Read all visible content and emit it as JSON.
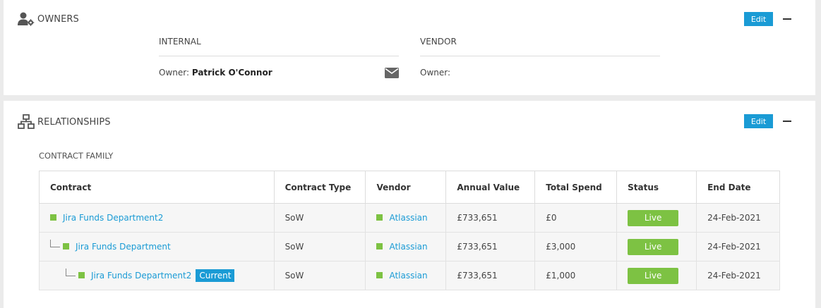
{
  "owners": {
    "title": "OWNERS",
    "edit_label": "Edit",
    "internal": {
      "heading": "INTERNAL",
      "owner_label": "Owner:",
      "owner_name": "Patrick O'Connor"
    },
    "vendor": {
      "heading": "VENDOR",
      "owner_label": "Owner:"
    }
  },
  "relationships": {
    "title": "RELATIONSHIPS",
    "edit_label": "Edit",
    "family_label": "CONTRACT FAMILY",
    "columns": [
      "Contract",
      "Contract Type",
      "Vendor",
      "Annual Value",
      "Total Spend",
      "Status",
      "End Date"
    ],
    "rows": [
      {
        "contract": "Jira Funds Department2",
        "type": "SoW",
        "vendor": "Atlassian",
        "annual_value": "£733,651",
        "total_spend": "£0",
        "status": "Live",
        "end_date": "24-Feb-2021"
      },
      {
        "contract": "Jira Funds Department",
        "type": "SoW",
        "vendor": "Atlassian",
        "annual_value": "£733,651",
        "total_spend": "£3,000",
        "status": "Live",
        "end_date": "24-Feb-2021"
      },
      {
        "contract": "Jira Funds Department2",
        "badge": "Current",
        "type": "SoW",
        "vendor": "Atlassian",
        "annual_value": "£733,651",
        "total_spend": "£1,000",
        "status": "Live",
        "end_date": "24-Feb-2021"
      }
    ]
  },
  "colors": {
    "accent": "#1a9bd5",
    "status_live": "#7dc243",
    "date_red": "#e03b3b"
  },
  "icons": {
    "owners": "user-gear-icon",
    "relationships": "hierarchy-icon",
    "mail": "envelope-icon",
    "contract_status": "green-square-icon"
  }
}
